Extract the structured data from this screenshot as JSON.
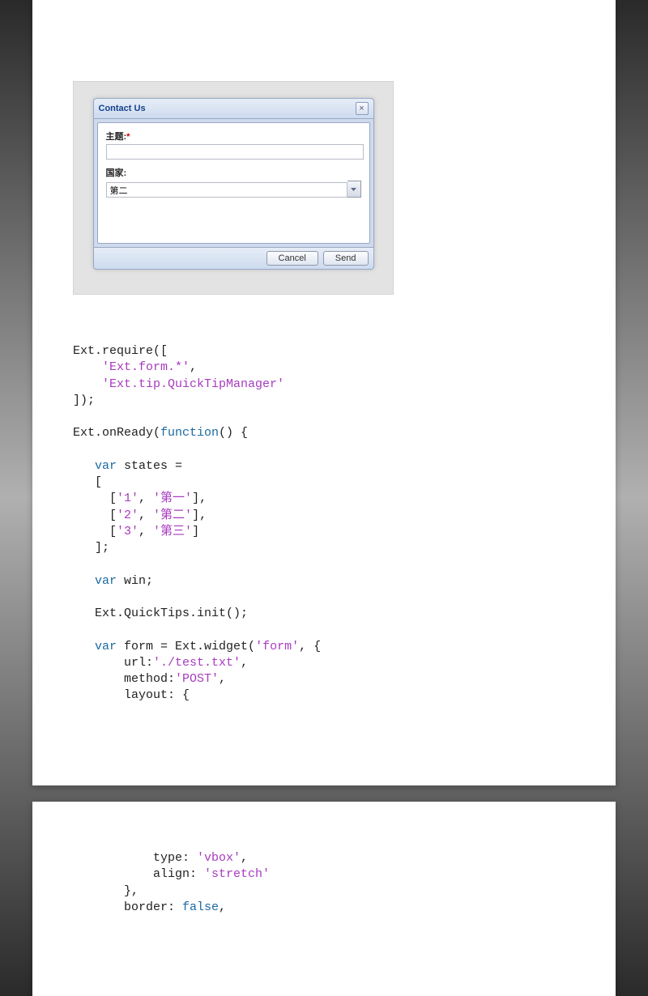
{
  "window": {
    "title": "Contact Us",
    "close_glyph": "×",
    "subject_label": "主题:",
    "subject_required": "*",
    "country_label": "国家:",
    "country_value": "第二",
    "cancel_label": "Cancel",
    "send_label": "Send"
  },
  "code1": {
    "l1a": "Ext.require([",
    "l2a": "    ",
    "l2s": "'Ext.form.*'",
    "l2b": ",",
    "l3a": "    ",
    "l3s": "'Ext.tip.QuickTipManager'",
    "l4a": "]);",
    "l5": "",
    "l6a": "Ext.onReady(",
    "l6k": "function",
    "l6b": "() {",
    "l7": "",
    "l8a": "   ",
    "l8k": "var",
    "l8b": " states =",
    "l9a": "   [",
    "l10a": "     [",
    "l10s1": "'1'",
    "l10b": ", ",
    "l10s2": "'第一'",
    "l10c": "],",
    "l11a": "     [",
    "l11s1": "'2'",
    "l11b": ", ",
    "l11s2": "'第二'",
    "l11c": "],",
    "l12a": "     [",
    "l12s1": "'3'",
    "l12b": ", ",
    "l12s2": "'第三'",
    "l12c": "]",
    "l13a": "   ];",
    "l14": "",
    "l15a": "   ",
    "l15k": "var",
    "l15b": " win;",
    "l16": "",
    "l17a": "   Ext.QuickTips.init();",
    "l18": "",
    "l19a": "   ",
    "l19k": "var",
    "l19b": " form = Ext.widget(",
    "l19s": "'form'",
    "l19c": ", {",
    "l20a": "       url:",
    "l20s": "'./test.txt'",
    "l20b": ",",
    "l21a": "       method:",
    "l21s": "'POST'",
    "l21b": ",",
    "l22a": "       layout: {"
  },
  "code2": {
    "l1a": "           type: ",
    "l1s": "'vbox'",
    "l1b": ",",
    "l2a": "           align: ",
    "l2s": "'stretch'",
    "l3a": "       },",
    "l4a": "       border: ",
    "l4k": "false",
    "l4b": ","
  }
}
